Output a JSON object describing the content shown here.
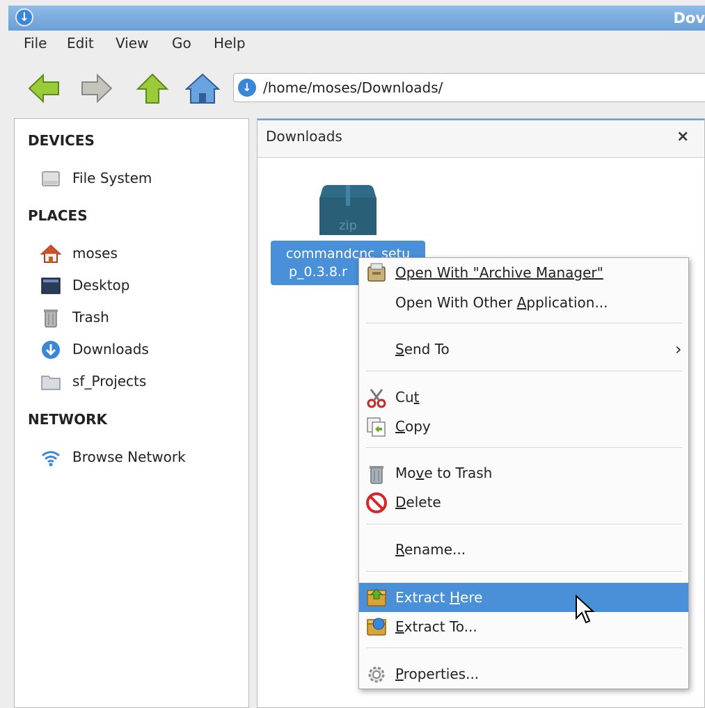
{
  "window": {
    "title": "Dov"
  },
  "menubar": {
    "items": [
      "File",
      "Edit",
      "View",
      "Go",
      "Help"
    ]
  },
  "location": {
    "path": "/home/moses/Downloads/"
  },
  "sidebar": {
    "devices_heading": "DEVICES",
    "devices": [
      {
        "label": "File System",
        "icon": "drive-icon"
      }
    ],
    "places_heading": "PLACES",
    "places": [
      {
        "label": "moses",
        "icon": "home-icon"
      },
      {
        "label": "Desktop",
        "icon": "desktop-icon"
      },
      {
        "label": "Trash",
        "icon": "trash-icon"
      },
      {
        "label": "Downloads",
        "icon": "download-icon"
      },
      {
        "label": "sf_Projects",
        "icon": "folder-icon"
      }
    ],
    "network_heading": "NETWORK",
    "network": [
      {
        "label": "Browse Network",
        "icon": "wifi-icon"
      }
    ]
  },
  "tab": {
    "label": "Downloads",
    "close": "×"
  },
  "file": {
    "icon_text": "zip",
    "name_line1": "commandcnc_setu",
    "name_line2": "p_0.3.8.r"
  },
  "context_menu": {
    "open_with_pre": "Open With \"Archive Manager\"",
    "open_other_a": "Open With Other ",
    "open_other_u": "A",
    "open_other_b": "pplication...",
    "send_to_u": "S",
    "send_to_rest": "end To",
    "send_to_arrow": "›",
    "cut_a": "Cu",
    "cut_u": "t",
    "copy_u": "C",
    "copy_rest": "opy",
    "move_a": "Mo",
    "move_u": "v",
    "move_b": "e to Trash",
    "delete_u": "D",
    "delete_rest": "elete",
    "rename_u": "R",
    "rename_rest": "ename...",
    "extract_here_a": "Extract ",
    "extract_here_u": "H",
    "extract_here_b": "ere",
    "extract_to_u": "E",
    "extract_to_rest": "xtract To...",
    "properties_u": "P",
    "properties_rest": "roperties..."
  },
  "colors": {
    "selection": "#4a90d9",
    "accent": "#3a86d8"
  }
}
